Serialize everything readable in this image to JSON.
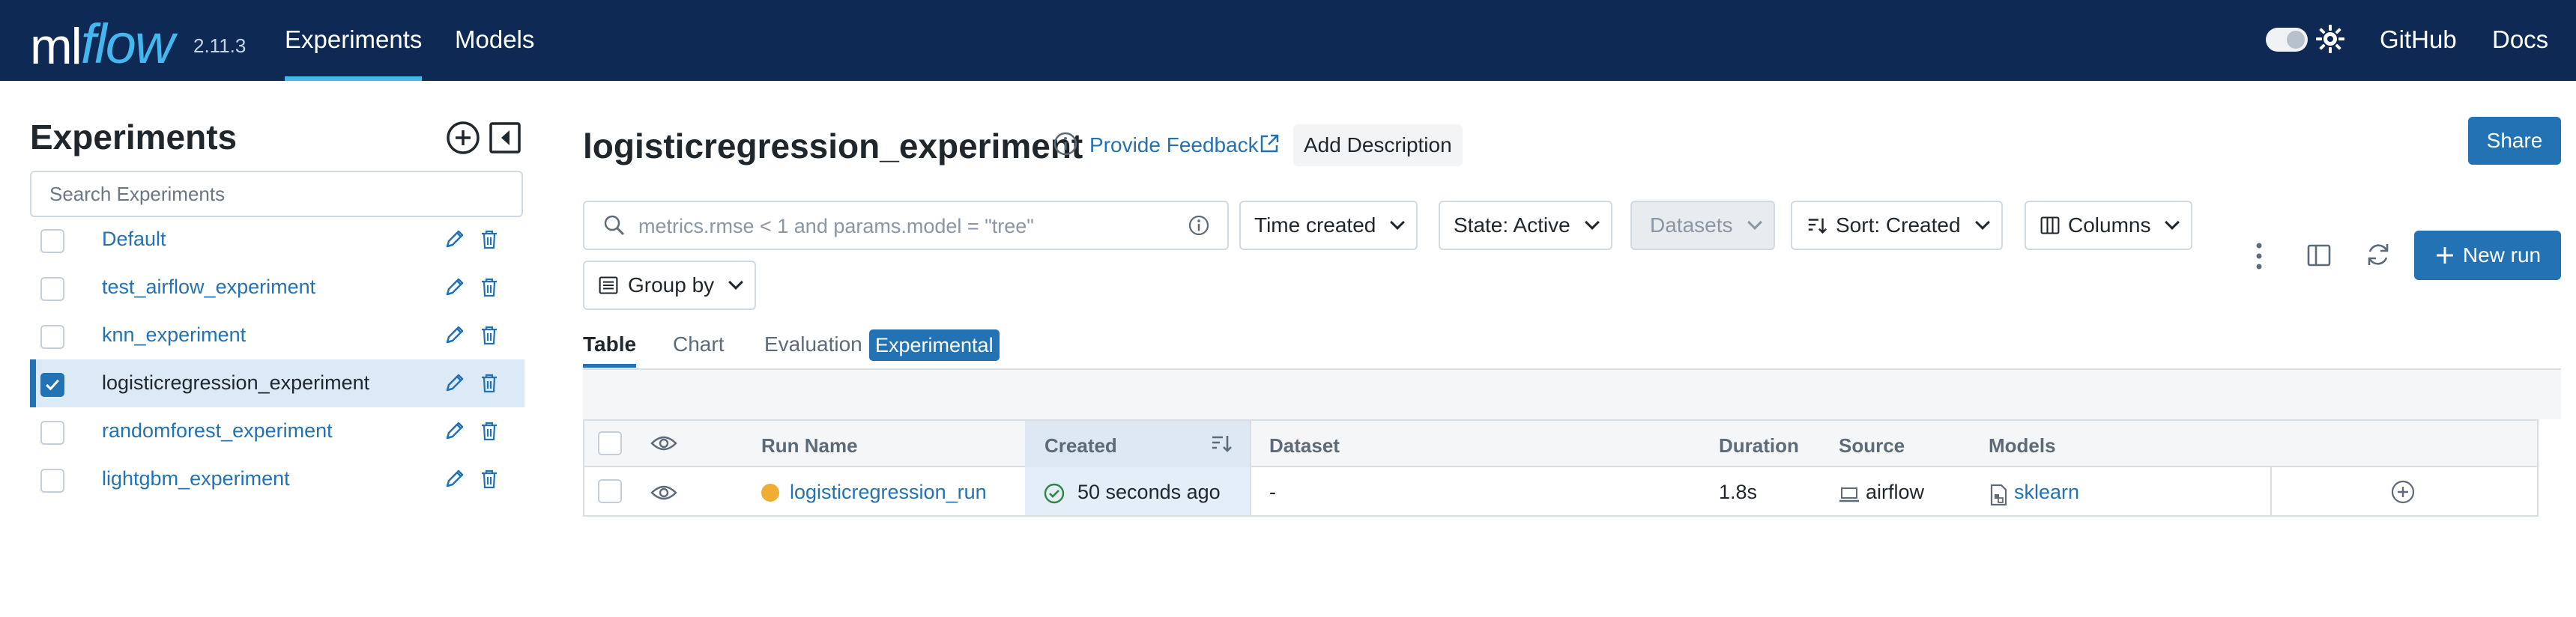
{
  "app": {
    "logo_ml": "ml",
    "logo_flow": "flow",
    "version": "2.11.3",
    "nav": [
      "Experiments",
      "Models"
    ],
    "nav_right": [
      "GitHub",
      "Docs"
    ]
  },
  "sidebar": {
    "title": "Experiments",
    "search_placeholder": "Search Experiments",
    "experiments": [
      {
        "name": "Default",
        "selected": false
      },
      {
        "name": "test_airflow_experiment",
        "selected": false
      },
      {
        "name": "knn_experiment",
        "selected": false
      },
      {
        "name": "logisticregression_experiment",
        "selected": true
      },
      {
        "name": "randomforest_experiment",
        "selected": false
      },
      {
        "name": "lightgbm_experiment",
        "selected": false
      }
    ]
  },
  "header": {
    "title": "logisticregression_experiment",
    "feedback": "Provide Feedback",
    "add_description": "Add Description",
    "share": "Share"
  },
  "filters": {
    "search_placeholder": "metrics.rmse < 1 and params.model = \"tree\"",
    "time_created": "Time created",
    "state": "State: Active",
    "datasets": "Datasets",
    "sort": "Sort: Created",
    "columns": "Columns",
    "group_by": "Group by",
    "new_run": "New run"
  },
  "view_tabs": {
    "table": "Table",
    "chart": "Chart",
    "evaluation": "Evaluation",
    "badge": "Experimental"
  },
  "table": {
    "headers": {
      "run_name": "Run Name",
      "created": "Created",
      "dataset": "Dataset",
      "duration": "Duration",
      "source": "Source",
      "models": "Models"
    },
    "rows": [
      {
        "run_name": "logisticregression_run",
        "created": "50 seconds ago",
        "dataset": "-",
        "duration": "1.8s",
        "source": "airflow",
        "models": "sklearn"
      }
    ]
  },
  "colors": {
    "nav_bg": "#0e2a54",
    "accent": "#2272b4",
    "logo_flow": "#43b7ee",
    "run_status": "#f0ad33",
    "success": "#2e8540"
  }
}
